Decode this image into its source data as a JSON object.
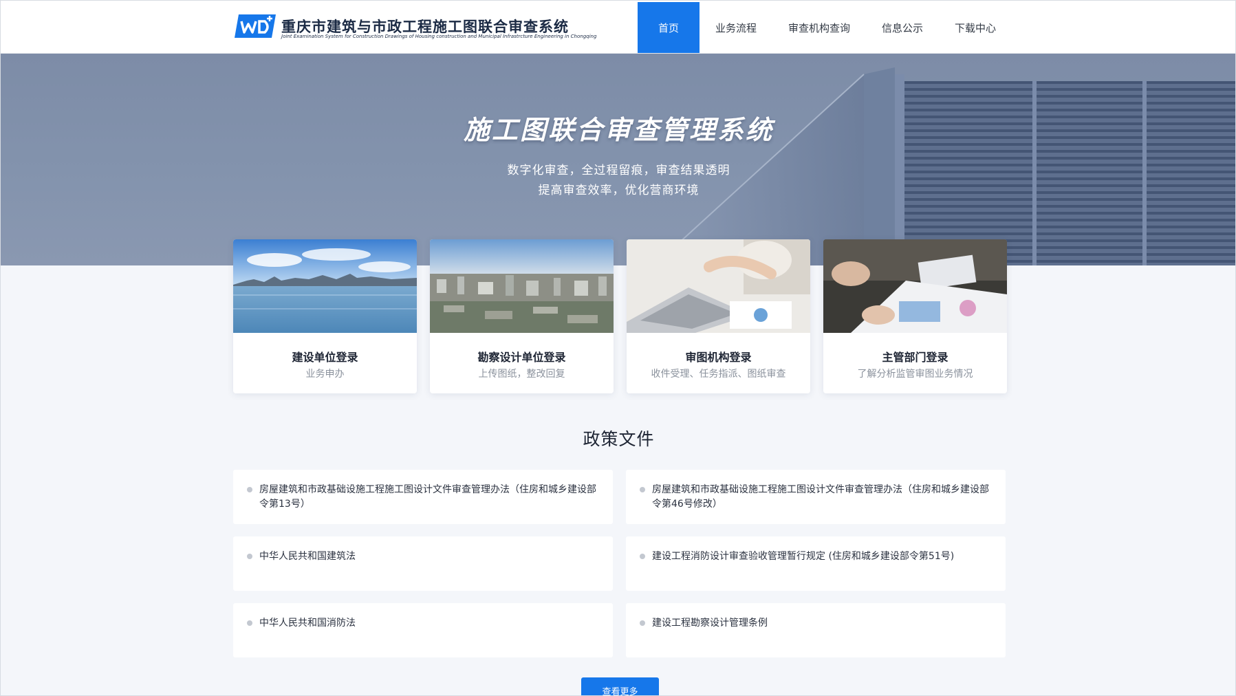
{
  "header": {
    "title": "重庆市建筑与市政工程施工图联合审查系统",
    "subtitle": "Joint Examination System for Construction Drawings of Housing construction and Municipal Infrastrcture Engineering in Chongqing",
    "nav": [
      {
        "label": "首页",
        "active": true
      },
      {
        "label": "业务流程",
        "active": false
      },
      {
        "label": "审查机构查询",
        "active": false
      },
      {
        "label": "信息公示",
        "active": false
      },
      {
        "label": "下载中心",
        "active": false
      }
    ]
  },
  "hero": {
    "title": "施工图联合审查管理系统",
    "line1": "数字化审查，全过程留痕，审查结果透明",
    "line2": "提高审查效率，优化营商环境"
  },
  "cards": [
    {
      "title": "建设单位登录",
      "desc": "业务申办"
    },
    {
      "title": "勘察设计单位登录",
      "desc": "上传图纸，整改回复"
    },
    {
      "title": "审图机构登录",
      "desc": "收件受理、任务指派、图纸审查"
    },
    {
      "title": "主管部门登录",
      "desc": "了解分析监管审图业务情况"
    }
  ],
  "policy": {
    "title": "政策文件",
    "items": [
      "房屋建筑和市政基础设施工程施工图设计文件审查管理办法（住房和城乡建设部令第13号）",
      "房屋建筑和市政基础设施工程施工图设计文件审查管理办法（住房和城乡建设部令第46号修改）",
      "中华人民共和国建筑法",
      "建设工程消防设计审查验收管理暂行规定 (住房和城乡建设部令第51号)",
      "中华人民共和国消防法",
      "建设工程勘察设计管理条例"
    ],
    "more_label": "查看更多"
  }
}
